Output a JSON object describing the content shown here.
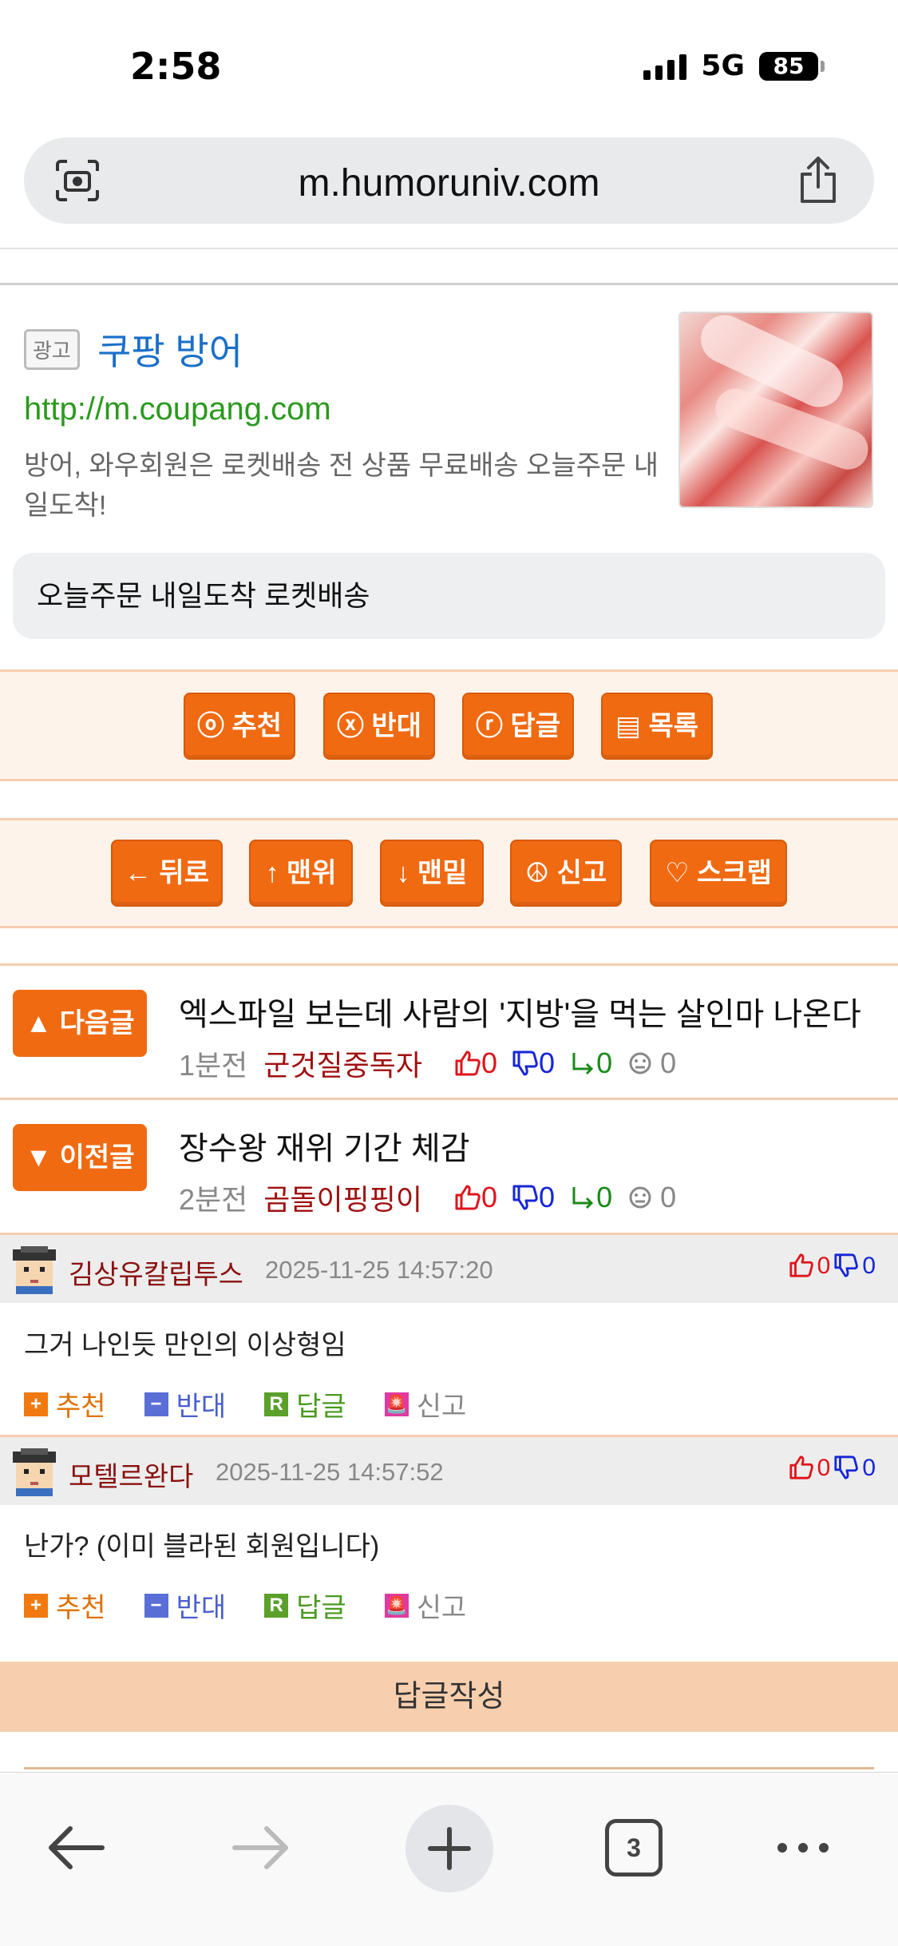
{
  "status": {
    "time": "2:58",
    "network": "5G",
    "battery": "85"
  },
  "browser": {
    "url": "m.humoruniv.com",
    "tab_count": "3"
  },
  "ad": {
    "badge": "광고",
    "title": "쿠팡 방어",
    "url": "http://m.coupang.com",
    "description": "방어, 와우회원은 로켓배송 전 상품 무료배송 오늘주문 내일도착!",
    "cta": "오늘주문 내일도착 로켓배송"
  },
  "actions1": [
    {
      "label": "ⓞ 추천"
    },
    {
      "label": "ⓧ 반대"
    },
    {
      "label": "ⓡ 답글"
    },
    {
      "label": "▤ 목록"
    }
  ],
  "actions2": [
    {
      "label": "← 뒤로"
    },
    {
      "label": "↑ 맨위"
    },
    {
      "label": "↓ 맨밑"
    },
    {
      "label": "☮ 신고"
    },
    {
      "label": "♡ 스크랩"
    }
  ],
  "next_post": {
    "button": "▲ 다음글",
    "title": "엑스파일 보는데 사람의 '지방'을 먹는 살인마 나온다",
    "time": "1분전",
    "author": "군것질중독자",
    "up": "0",
    "down": "0",
    "replies": "0",
    "views": "0"
  },
  "prev_post": {
    "button": "▼ 이전글",
    "title": "장수왕 재위 기간 체감",
    "time": "2분전",
    "author": "곰돌이핑핑이",
    "up": "0",
    "down": "0",
    "replies": "0",
    "views": "0"
  },
  "comments": [
    {
      "author": "김상유칼립투스",
      "date": "2025-11-25 14:57:20",
      "up": "0",
      "down": "0",
      "text": "그거 나인듯 만인의 이상형임"
    },
    {
      "author": "모텔르완다",
      "date": "2025-11-25 14:57:52",
      "up": "0",
      "down": "0",
      "text": "난가? (이미 블라된 회원입니다)"
    }
  ],
  "comment_actions": {
    "recommend": "추천",
    "oppose": "반대",
    "reply": "답글",
    "report": "신고"
  },
  "reply_write": "답글작성",
  "colors": {
    "accent": "#f06a12",
    "panel": "#fdf3ea",
    "up": "#e0141b",
    "down": "#1726d6",
    "reply": "#1a8a1a"
  },
  "icons": [
    "camera-search-icon",
    "share-icon",
    "thumbs-up-icon",
    "thumbs-down-icon",
    "reply-arrow-icon",
    "view-face-icon",
    "back-icon",
    "forward-icon",
    "plus-icon",
    "tabs-icon",
    "more-icon"
  ]
}
